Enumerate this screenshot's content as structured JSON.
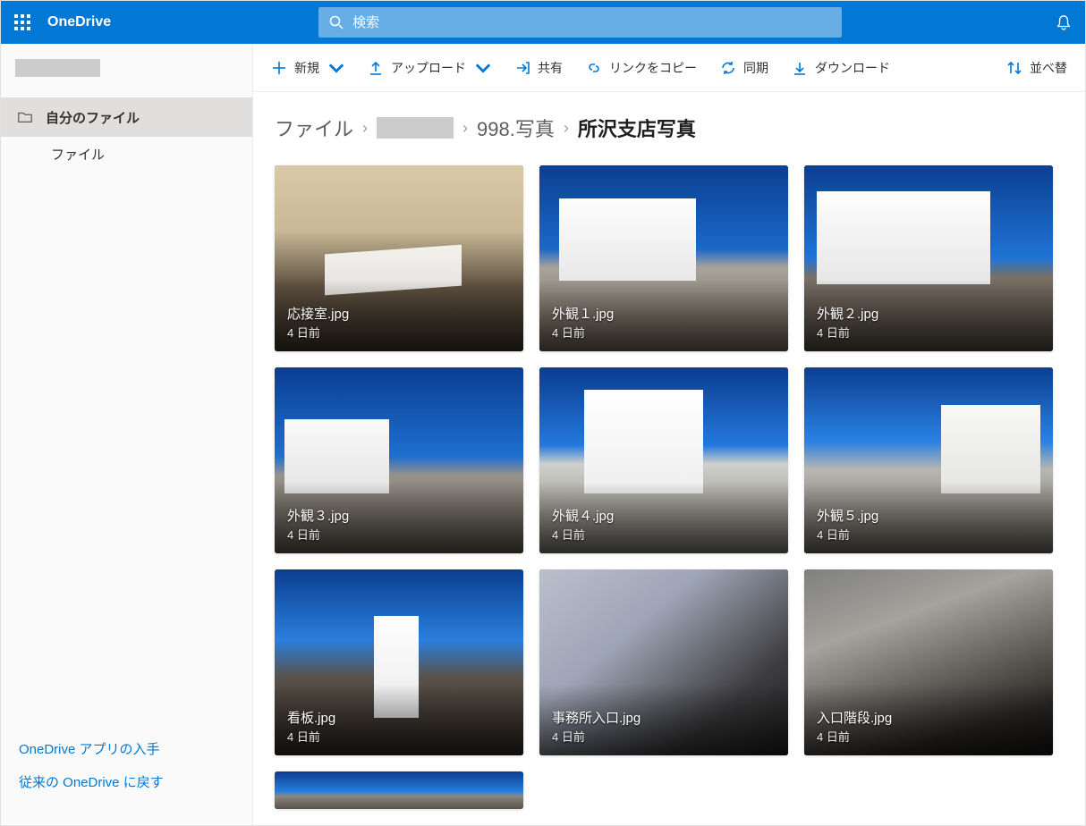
{
  "brand": "OneDrive",
  "search_placeholder": "検索",
  "sidebar": {
    "my_files": "自分のファイル",
    "files": "ファイル",
    "footer_get_app": "OneDrive アプリの入手",
    "footer_classic": "従来の OneDrive に戻す"
  },
  "toolbar": {
    "new": "新規",
    "upload": "アップロード",
    "share": "共有",
    "copy_link": "リンクをコピー",
    "sync": "同期",
    "download": "ダウンロード",
    "sort": "並べ替"
  },
  "breadcrumb": {
    "root": "ファイル",
    "b2": "998.写真",
    "current": "所沢支店写真"
  },
  "files": [
    {
      "name": "応接室.jpg",
      "modified": "4 日前"
    },
    {
      "name": "外観１.jpg",
      "modified": "4 日前"
    },
    {
      "name": "外観２.jpg",
      "modified": "4 日前"
    },
    {
      "name": "外観３.jpg",
      "modified": "4 日前"
    },
    {
      "name": "外観４.jpg",
      "modified": "4 日前"
    },
    {
      "name": "外観５.jpg",
      "modified": "4 日前"
    },
    {
      "name": "看板.jpg",
      "modified": "4 日前"
    },
    {
      "name": "事務所入口.jpg",
      "modified": "4 日前"
    },
    {
      "name": "入口階段.jpg",
      "modified": "4 日前"
    }
  ]
}
